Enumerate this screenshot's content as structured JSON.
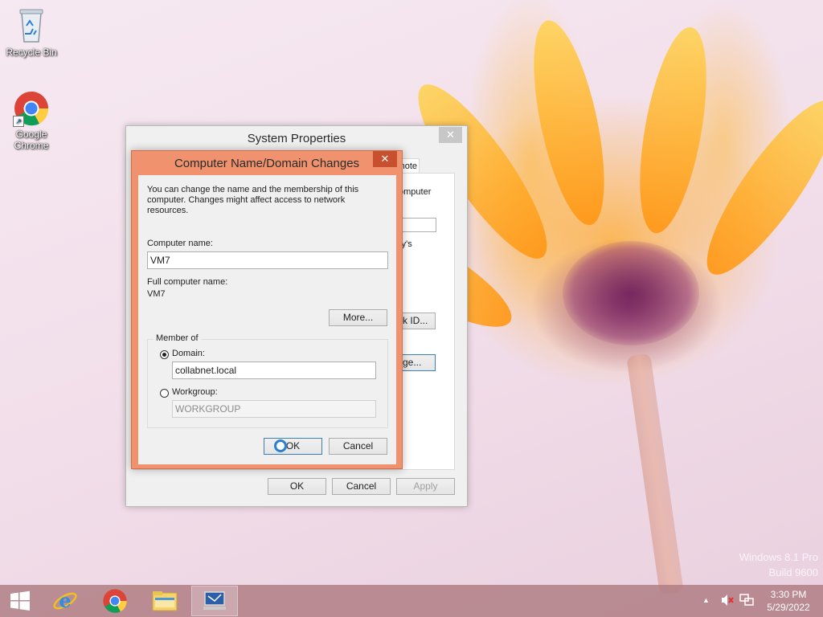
{
  "desktop": {
    "icons": [
      {
        "label": "Recycle Bin"
      },
      {
        "label": "Google Chrome"
      }
    ],
    "watermark": {
      "line1": "Windows 8.1 Pro",
      "line2": "Build 9600"
    }
  },
  "system_properties": {
    "title": "System Properties",
    "tab_partial": "note",
    "partial_text_1": "omputer",
    "partial_text_2": "ry's",
    "network_id_partial": "k ID...",
    "change_partial": "ge...",
    "ok_label": "OK",
    "cancel_label": "Cancel",
    "apply_label": "Apply"
  },
  "name_dialog": {
    "title": "Computer Name/Domain Changes",
    "description": "You can change the name and the membership of this computer. Changes might affect access to network resources.",
    "computer_name_label": "Computer name:",
    "computer_name_value": "VM7",
    "full_name_label": "Full computer name:",
    "full_name_value": "VM7",
    "more_label": "More...",
    "member_of_label": "Member of",
    "domain_label": "Domain:",
    "domain_value": "collabnet.local",
    "workgroup_label": "Workgroup:",
    "workgroup_value": "WORKGROUP",
    "ok_label": "OK",
    "cancel_label": "Cancel",
    "domain_selected": true,
    "accent_color": "#f0926d"
  },
  "taskbar": {
    "time": "3:30 PM",
    "date": "5/29/2022",
    "color": "#b07e84"
  }
}
